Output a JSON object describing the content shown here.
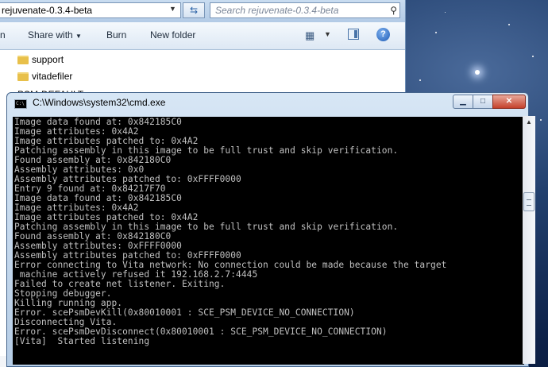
{
  "explorer": {
    "address_text": "rejuvenate-0.3.4-beta",
    "search_placeholder": "Search rejuvenate-0.3.4-beta",
    "toolbar": {
      "open_label": "n",
      "share_label": "Share with",
      "burn_label": "Burn",
      "new_folder_label": "New folder"
    },
    "files": [
      {
        "name": "support"
      },
      {
        "name": "vitadefiler"
      }
    ],
    "partial_file": "PSM-DEFAULT..."
  },
  "cmd": {
    "title": "C:\\Windows\\system32\\cmd.exe",
    "lines": [
      "Image data found at: 0x842185C0",
      "Image attributes: 0x4A2",
      "Image attributes patched to: 0x4A2",
      "Patching assembly in this image to be full trust and skip verification.",
      "Found assembly at: 0x842180C0",
      "Assembly attributes: 0x0",
      "Assembly attributes patched to: 0xFFFF0000",
      "Entry 9 found at: 0x84217F70",
      "Image data found at: 0x842185C0",
      "Image attributes: 0x4A2",
      "Image attributes patched to: 0x4A2",
      "Patching assembly in this image to be full trust and skip verification.",
      "Found assembly at: 0x842180C0",
      "Assembly attributes: 0xFFFF0000",
      "Assembly attributes patched to: 0xFFFF0000",
      "Error connecting to Vita network: No connection could be made because the target",
      " machine actively refused it 192.168.2.7:4445",
      "Failed to create net listener. Exiting.",
      "Stopping debugger.",
      "Killing running app.",
      "Error. scePsmDevKill(0x80010001 : SCE_PSM_DEVICE_NO_CONNECTION)",
      "Disconnecting Vita.",
      "Error. scePsmDevDisconnect(0x80010001 : SCE_PSM_DEVICE_NO_CONNECTION)",
      "[Vita]  Started listening"
    ]
  }
}
